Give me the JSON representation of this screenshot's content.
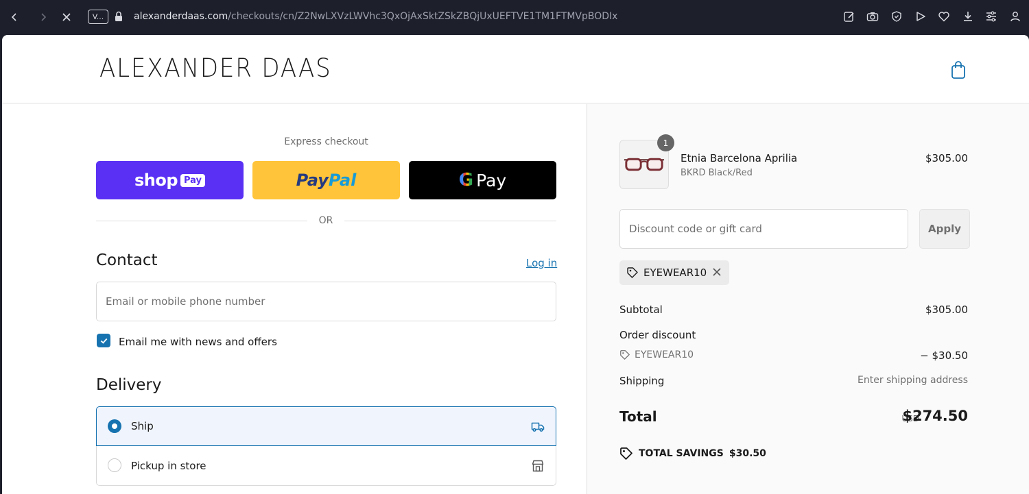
{
  "browser": {
    "site_badge": "V...",
    "url_host": "alexanderdaas.com",
    "url_path": "/checkouts/cn/Z2NwLXVzLWVhc3QxOjAxSktZSkZBQjUxUEFTVE1TM1FTMVpBODIx"
  },
  "header": {
    "brand": "ALEXANDER DAAS",
    "bag_icon": "shopping-bag-icon"
  },
  "express": {
    "title": "Express checkout",
    "shoppay_label": "shop",
    "shoppay_pill": "Pay",
    "paypal_part1": "Pay",
    "paypal_part2": "Pal",
    "gpay_g": "G",
    "gpay_label": "Pay",
    "or": "OR"
  },
  "contact": {
    "title": "Contact",
    "login": "Log in",
    "email_placeholder": "Email or mobile phone number",
    "newsletter_label": "Email me with news and offers",
    "newsletter_checked": true
  },
  "delivery": {
    "title": "Delivery",
    "options": [
      {
        "label": "Ship",
        "selected": true,
        "icon": "truck-icon"
      },
      {
        "label": "Pickup in store",
        "selected": false,
        "icon": "store-icon"
      }
    ]
  },
  "cart": {
    "item": {
      "quantity": "1",
      "name": "Etnia Barcelona Aprilia",
      "variant": "BKRD Black/Red",
      "price": "$305.00"
    },
    "discount_placeholder": "Discount code or gift card",
    "apply_label": "Apply",
    "applied_code": "EYEWEAR10",
    "summary": {
      "subtotal_label": "Subtotal",
      "subtotal_value": "$305.00",
      "order_discount_label": "Order discount",
      "discount_code": "EYEWEAR10",
      "discount_value": "− $30.50",
      "shipping_label": "Shipping",
      "shipping_value": "Enter shipping address",
      "total_label": "Total",
      "total_currency": "USD",
      "total_value": "$274.50",
      "savings_label": "TOTAL SAVINGS",
      "savings_value": "$30.50"
    }
  },
  "colors": {
    "accent": "#1773b0",
    "shoppay": "#5a31f4",
    "paypal": "#ffc439",
    "gpay": "#000000"
  }
}
